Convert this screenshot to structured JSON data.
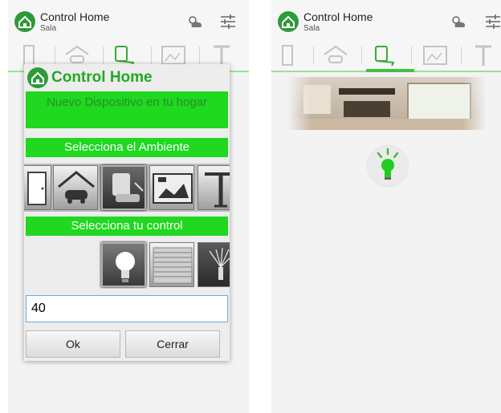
{
  "left_screen": {
    "app_title": "Control Home",
    "room_subtitle": "Sala",
    "dialog": {
      "title": "Control Home",
      "header_message": "Nuevo Dispositivo en tu hogar",
      "environment_prompt": "Selecciona el Ambiente",
      "control_prompt": "Selecciona tu control",
      "value_input": "40",
      "ok_label": "Ok",
      "close_label": "Cerrar"
    }
  },
  "right_screen": {
    "app_title": "Control Home",
    "room_subtitle": "Sala"
  },
  "icons": [
    "home-logo-icon",
    "weather-icon",
    "settings-sliders-icon",
    "door-icon",
    "garage-car-icon",
    "armchair-icon",
    "kitchen-icon",
    "sprinkler-icon",
    "light-bulb-icon",
    "blinds-icon"
  ],
  "colors": {
    "accent_green": "#1fd81f",
    "logo_green": "#2f9a3a",
    "tab_underline": "#41c241",
    "title_green": "#23a823"
  }
}
